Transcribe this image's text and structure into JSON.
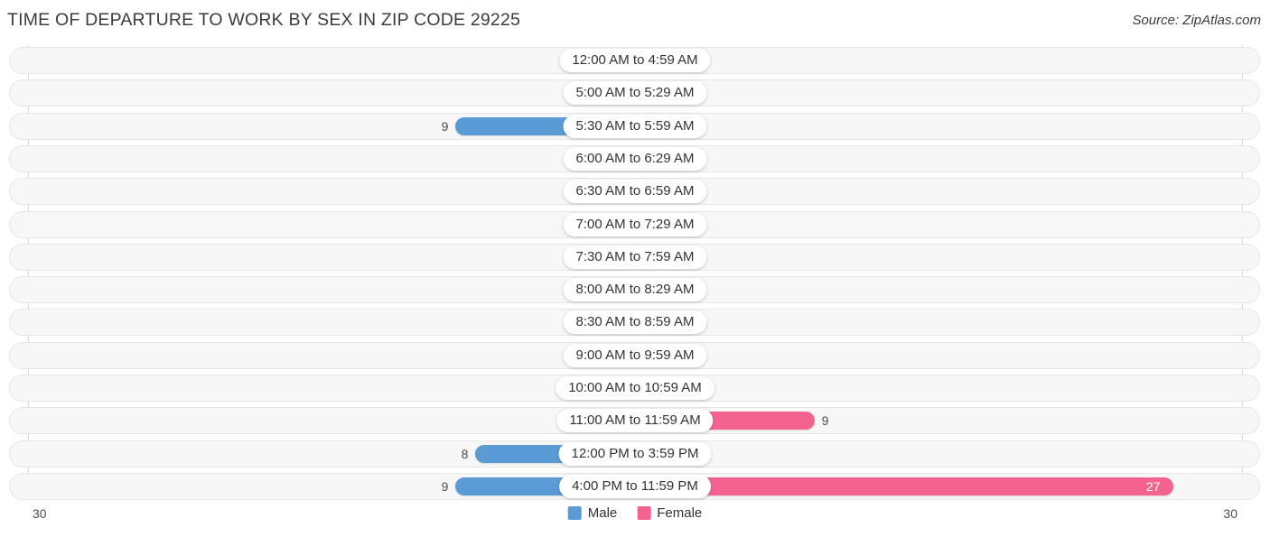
{
  "header": {
    "title": "TIME OF DEPARTURE TO WORK BY SEX IN ZIP CODE 29225",
    "source": "Source: ZipAtlas.com"
  },
  "axis": {
    "left_tick": "30",
    "right_tick": "30",
    "max": 30
  },
  "legend": [
    {
      "label": "Male",
      "color": "#5b9bd5"
    },
    {
      "label": "Female",
      "color": "#f4628f"
    }
  ],
  "colors": {
    "male_strong": "#5b9bd5",
    "male_muted": "#aec9ec",
    "female_strong": "#f4628f",
    "female_muted": "#f7a8c4",
    "track": "#f7f7f7",
    "track_border": "#e6e6e6",
    "axis": "#d8d8d8",
    "text": "#3c3c3c"
  },
  "chart_data": {
    "type": "bar",
    "title": "TIME OF DEPARTURE TO WORK BY SEX IN ZIP CODE 29225",
    "subtitle": "",
    "xlabel": "",
    "ylabel": "",
    "orientation": "horizontal-diverging",
    "xlim": [
      30,
      30
    ],
    "grid": false,
    "legend_position": "bottom-center",
    "categories": [
      "12:00 AM to 4:59 AM",
      "5:00 AM to 5:29 AM",
      "5:30 AM to 5:59 AM",
      "6:00 AM to 6:29 AM",
      "6:30 AM to 6:59 AM",
      "7:00 AM to 7:29 AM",
      "7:30 AM to 7:59 AM",
      "8:00 AM to 8:29 AM",
      "8:30 AM to 8:59 AM",
      "9:00 AM to 9:59 AM",
      "10:00 AM to 10:59 AM",
      "11:00 AM to 11:59 AM",
      "12:00 PM to 3:59 PM",
      "4:00 PM to 11:59 PM"
    ],
    "series": [
      {
        "name": "Male",
        "values": [
          0,
          0,
          9,
          0,
          0,
          0,
          0,
          0,
          0,
          0,
          0,
          0,
          8,
          9
        ]
      },
      {
        "name": "Female",
        "values": [
          0,
          0,
          0,
          0,
          0,
          0,
          0,
          0,
          0,
          0,
          0,
          9,
          0,
          27
        ]
      }
    ]
  },
  "rows": [
    {
      "label": "12:00 AM to 4:59 AM",
      "male": "0",
      "female": "0"
    },
    {
      "label": "5:00 AM to 5:29 AM",
      "male": "0",
      "female": "0"
    },
    {
      "label": "5:30 AM to 5:59 AM",
      "male": "9",
      "female": "0"
    },
    {
      "label": "6:00 AM to 6:29 AM",
      "male": "0",
      "female": "0"
    },
    {
      "label": "6:30 AM to 6:59 AM",
      "male": "0",
      "female": "0"
    },
    {
      "label": "7:00 AM to 7:29 AM",
      "male": "0",
      "female": "0"
    },
    {
      "label": "7:30 AM to 7:59 AM",
      "male": "0",
      "female": "0"
    },
    {
      "label": "8:00 AM to 8:29 AM",
      "male": "0",
      "female": "0"
    },
    {
      "label": "8:30 AM to 8:59 AM",
      "male": "0",
      "female": "0"
    },
    {
      "label": "9:00 AM to 9:59 AM",
      "male": "0",
      "female": "0"
    },
    {
      "label": "10:00 AM to 10:59 AM",
      "male": "0",
      "female": "0"
    },
    {
      "label": "11:00 AM to 11:59 AM",
      "male": "0",
      "female": "9"
    },
    {
      "label": "12:00 PM to 3:59 PM",
      "male": "8",
      "female": "0"
    },
    {
      "label": "4:00 PM to 11:59 PM",
      "male": "9",
      "female": "27"
    }
  ]
}
